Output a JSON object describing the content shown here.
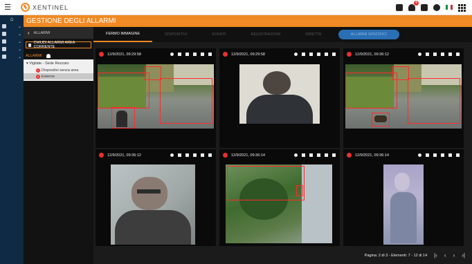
{
  "topbar": {
    "logo_text": "XENTINEL",
    "notification_count": "4"
  },
  "header": {
    "title": "GESTIONE DEGLI ALLARMI"
  },
  "left_panel": {
    "section": "ALLARMI",
    "close_button": "CHIUDI ALLARMI AREA CORRENTE",
    "list_title": "ALLARMI",
    "tree_root": "Vigilate - Sede Rezzato",
    "items": [
      {
        "badge": "1",
        "label": "Dispositivi senza area"
      },
      {
        "badge": "2",
        "label": "Esterno"
      }
    ]
  },
  "tabs": [
    {
      "label": "FERMO IMMAGINE",
      "state": "active"
    },
    {
      "label": "DISPOSITIVI",
      "state": "disabled"
    },
    {
      "label": "EVENTI",
      "state": "disabled"
    },
    {
      "label": "REGISTRAZIONI",
      "state": "disabled"
    },
    {
      "label": "DIRETTE",
      "state": "disabled"
    },
    {
      "label": "ALLARMI SPECIFICI",
      "state": "pill"
    }
  ],
  "tiles": [
    {
      "timestamp": "12/9/2021, 09:29:58",
      "image": "driveway-overview"
    },
    {
      "timestamp": "12/9/2021, 09:29:58",
      "image": "person-back"
    },
    {
      "timestamp": "12/9/2021, 09:36:12",
      "image": "driveway-dog"
    },
    {
      "timestamp": "12/9/2021, 09:36:12",
      "image": "person-face-glasses"
    },
    {
      "timestamp": "12/9/2021, 09:36:14",
      "image": "garden-overview"
    },
    {
      "timestamp": "12/9/2021, 09:36:14",
      "image": "blurred-person"
    }
  ],
  "pager": {
    "text": "Pagina: 2 di 3 - Elementi: 7 - 12 di 14"
  },
  "colors": {
    "accent": "#f08a24",
    "rail": "#0f2a44",
    "alert": "#e8312f"
  }
}
